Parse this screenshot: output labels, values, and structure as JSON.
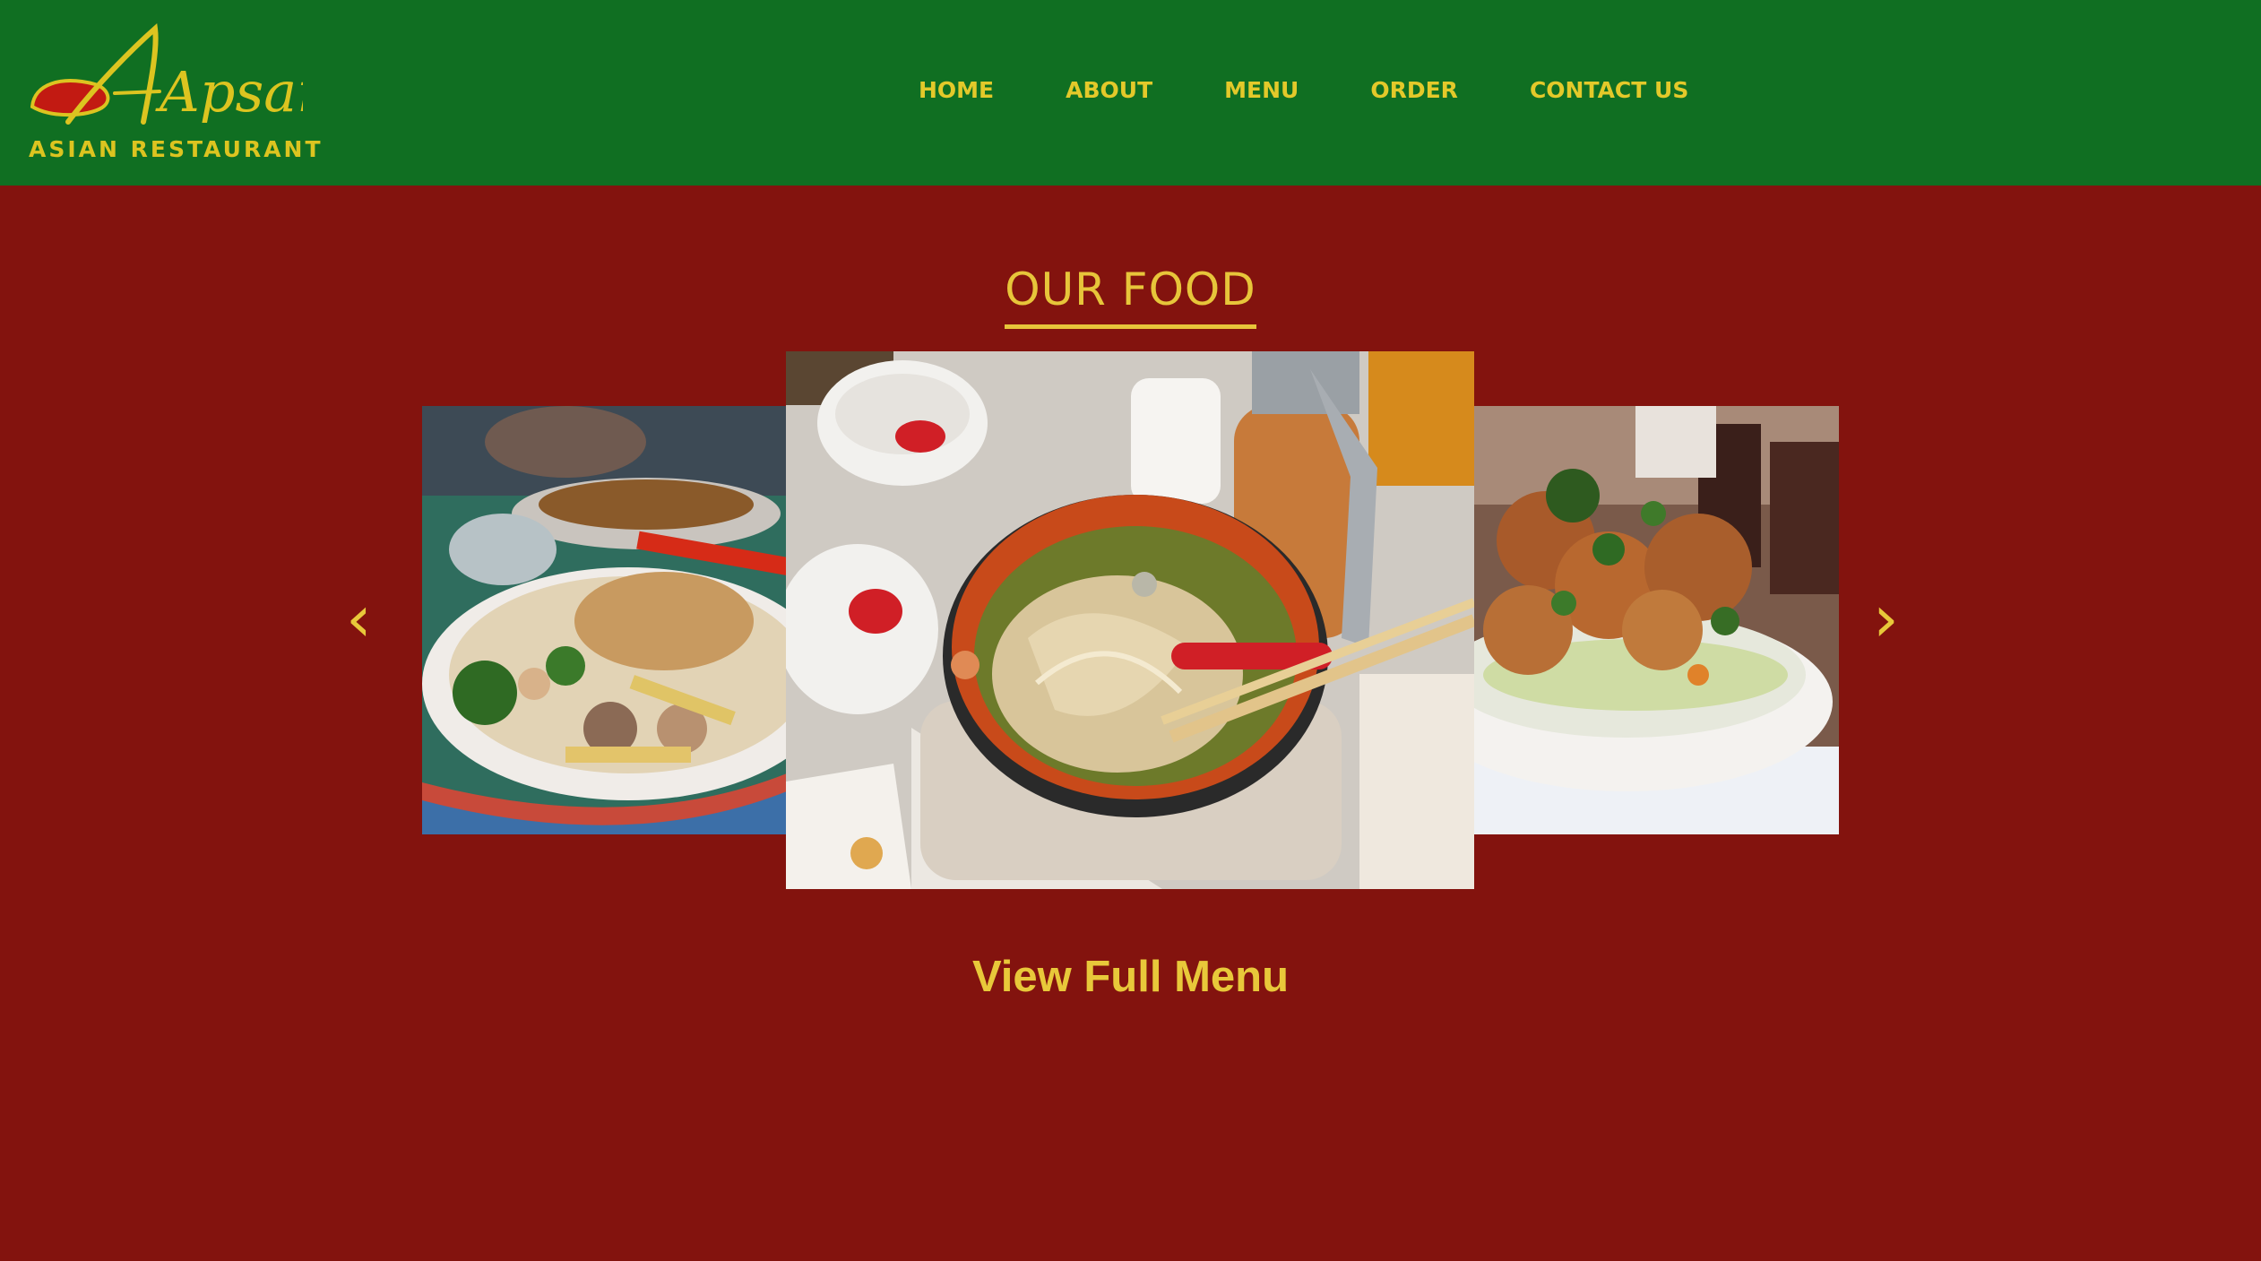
{
  "brand": {
    "name": "Apsara",
    "tagline": "ASIAN RESTAURANT",
    "colors": {
      "header_bg": "#106f22",
      "page_bg": "#83130e",
      "accent": "#e3c92a"
    }
  },
  "nav": {
    "items": [
      {
        "label": "HOME"
      },
      {
        "label": "ABOUT"
      },
      {
        "label": "MENU"
      },
      {
        "label": "ORDER"
      },
      {
        "label": "CONTACT US"
      }
    ]
  },
  "food_section": {
    "title": "OUR FOOD",
    "prev_icon": "‹",
    "next_icon": "›",
    "slides": [
      {
        "icon": "noodle-bowl-photo"
      },
      {
        "icon": "pho-soup-photo"
      },
      {
        "icon": "fried-chicken-photo"
      }
    ],
    "cta_label": "View Full Menu"
  }
}
